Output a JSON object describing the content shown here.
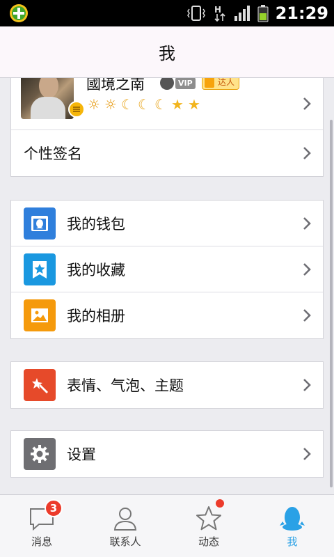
{
  "status_bar": {
    "time": "21:29"
  },
  "header": {
    "title": "我"
  },
  "profile": {
    "nickname": "國境之南",
    "vip_tag": "VIP",
    "daren_tag": "达人",
    "level_icons": [
      "sun-icon",
      "sun-icon",
      "moon-icon",
      "moon-icon",
      "moon-icon",
      "star-icon",
      "star-icon"
    ]
  },
  "signature": {
    "label": "个性签名"
  },
  "menu_group1": {
    "items": [
      {
        "label": "我的钱包",
        "color": "#2f7fdc",
        "icon": "wallet-icon"
      },
      {
        "label": "我的收藏",
        "color": "#1a98e0",
        "icon": "favorites-icon"
      },
      {
        "label": "我的相册",
        "color": "#f59a0c",
        "icon": "album-icon"
      }
    ]
  },
  "menu_group2": {
    "items": [
      {
        "label": "表情、气泡、主题",
        "color": "#e64a2a",
        "icon": "theme-wand-icon"
      }
    ]
  },
  "menu_group3": {
    "items": [
      {
        "label": "设置",
        "color": "#6e6e72",
        "icon": "gear-icon"
      }
    ]
  },
  "tabs": [
    {
      "label": "消息",
      "icon": "message-icon",
      "badge": "3"
    },
    {
      "label": "联系人",
      "icon": "contacts-icon"
    },
    {
      "label": "动态",
      "icon": "star-icon"
    },
    {
      "label": "我",
      "icon": "penguin-icon"
    }
  ],
  "colors": {
    "accent": "#2aa1e6",
    "badge": "#ec3b2b"
  }
}
